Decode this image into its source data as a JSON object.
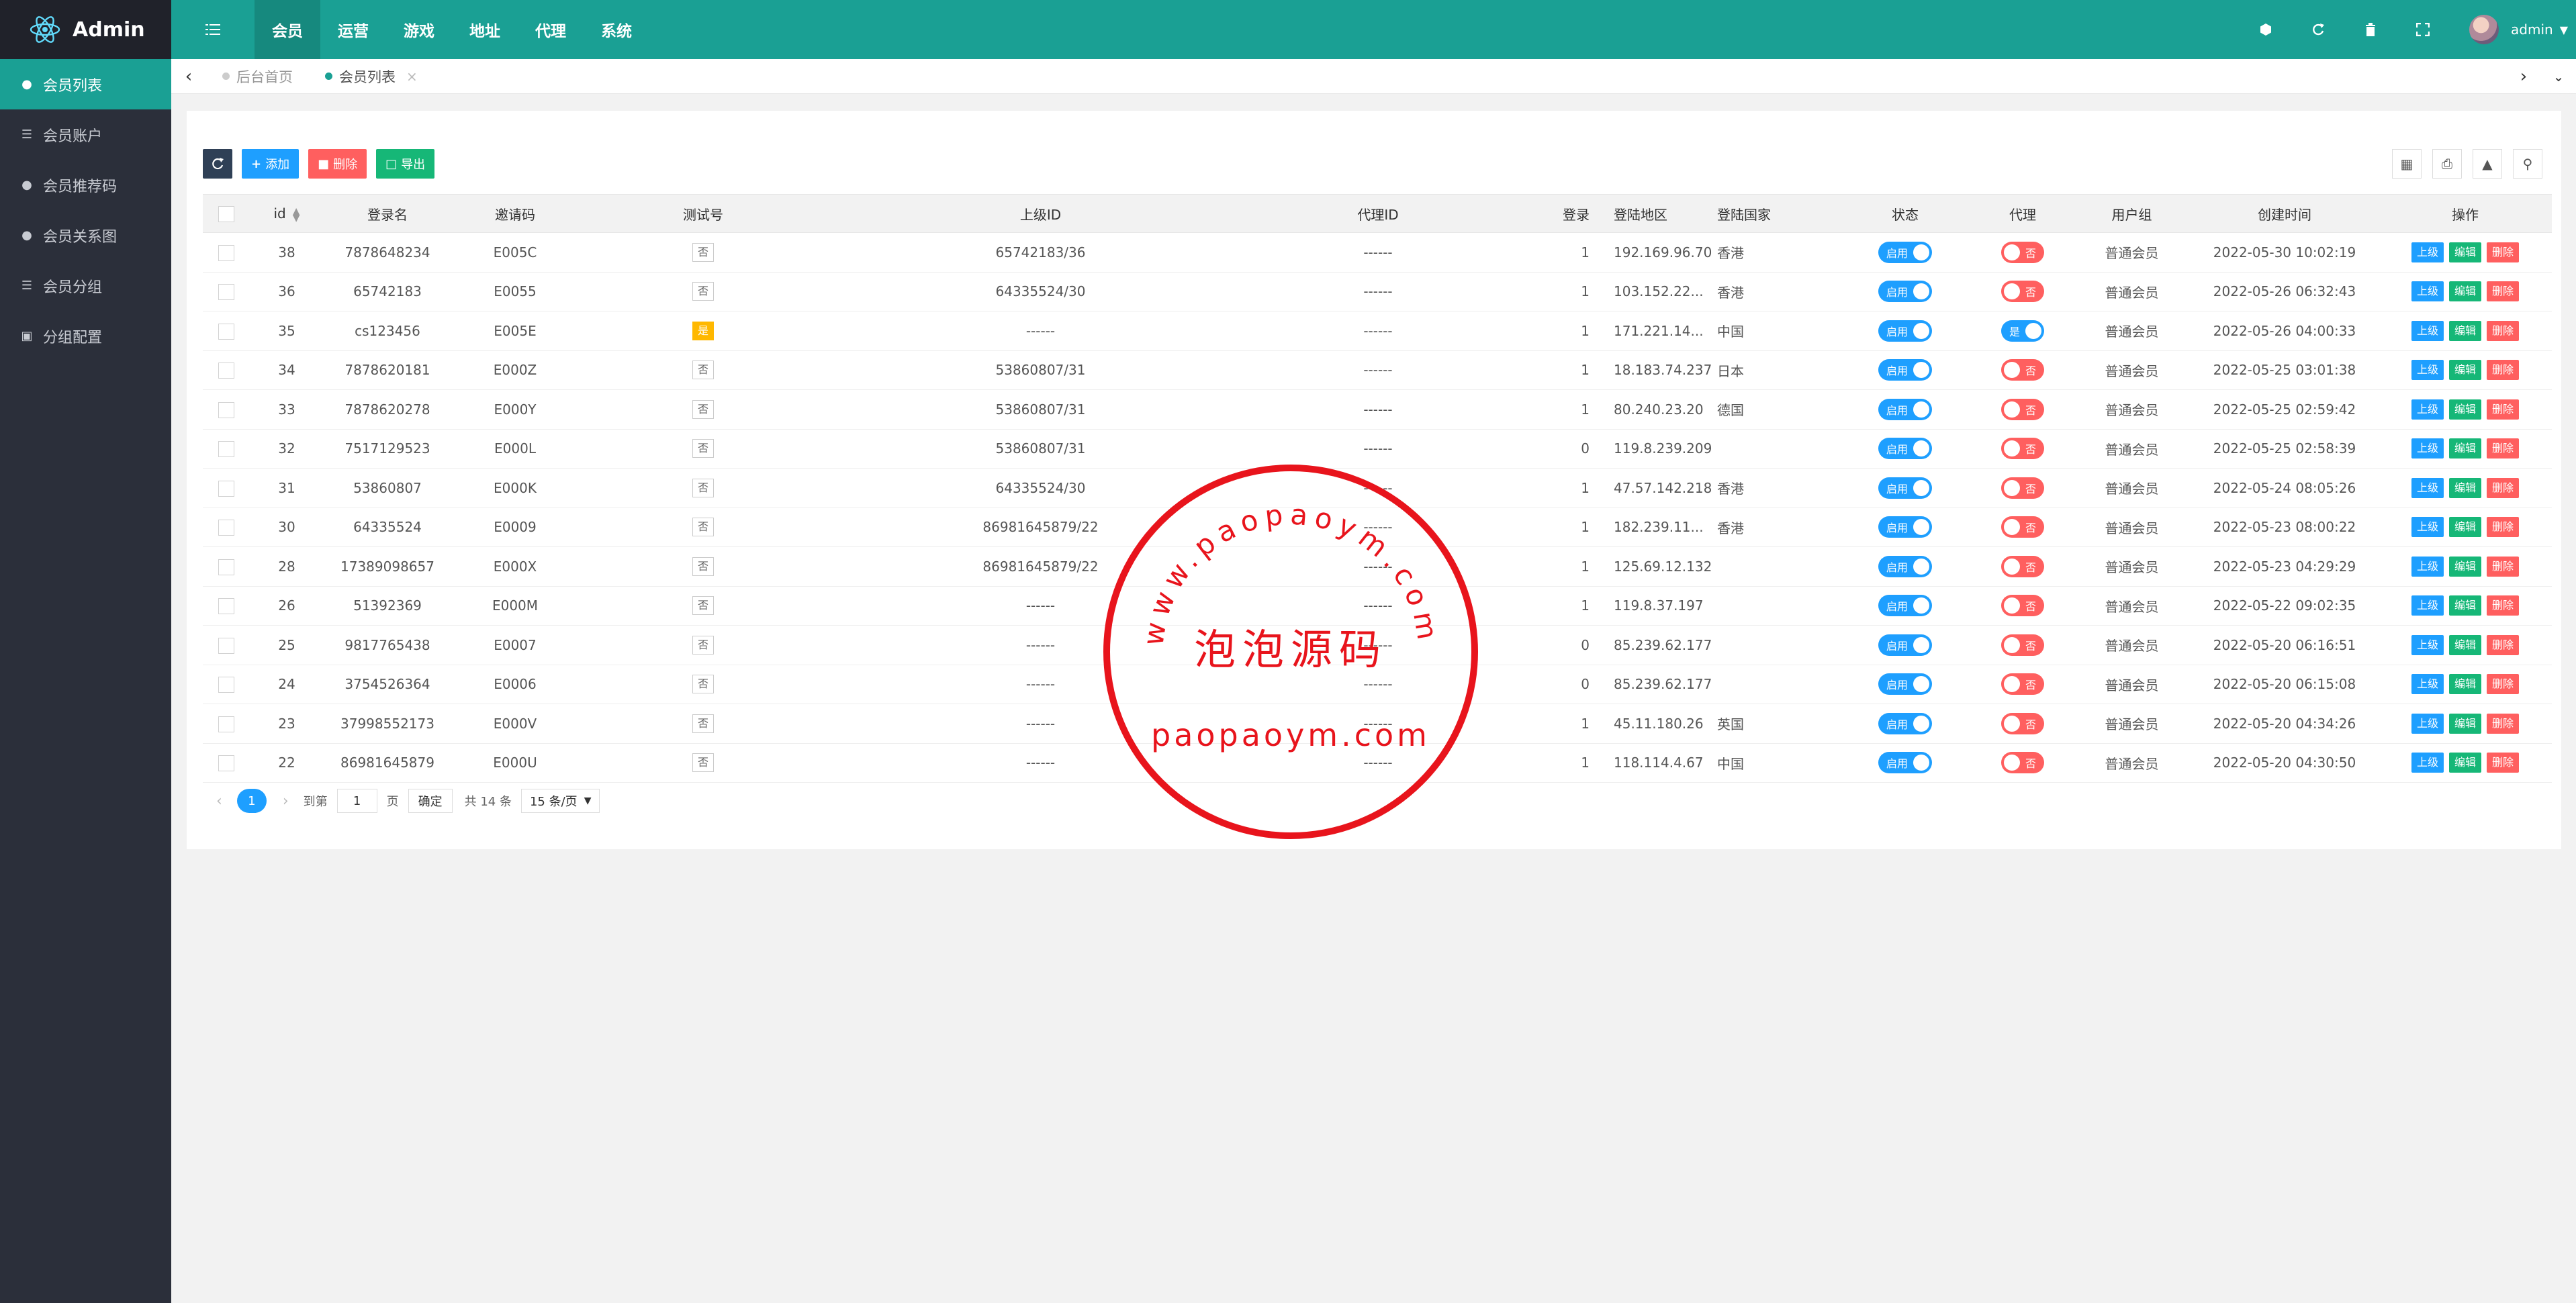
{
  "app": {
    "title": "Admin"
  },
  "header": {
    "nav": [
      "会员",
      "运营",
      "游戏",
      "地址",
      "代理",
      "系统"
    ],
    "username": "admin"
  },
  "sidebar": {
    "items": [
      {
        "label": "会员列表",
        "icon": "user-icon"
      },
      {
        "label": "会员账户",
        "icon": "list-icon"
      },
      {
        "label": "会员推荐码",
        "icon": "user-plus-icon"
      },
      {
        "label": "会员关系图",
        "icon": "users-icon"
      },
      {
        "label": "会员分组",
        "icon": "list-icon"
      },
      {
        "label": "分组配置",
        "icon": "file-icon"
      }
    ]
  },
  "tabs": [
    {
      "label": "后台首页"
    },
    {
      "label": "会员列表"
    }
  ],
  "toolbar": {
    "add": "添加",
    "delete": "删除",
    "export": "导出"
  },
  "table": {
    "columns": [
      "id",
      "登录名",
      "邀请码",
      "测试号",
      "上级ID",
      "代理ID",
      "登录",
      "登陆地区",
      "登陆国家",
      "状态",
      "代理",
      "用户组",
      "创建时间",
      "操作"
    ],
    "labels": {
      "on": "启用",
      "yes": "是",
      "no": "否",
      "up": "上级",
      "edit": "编辑",
      "del": "删除"
    },
    "rows": [
      {
        "id": "38",
        "login": "7878648234",
        "code": "E005C",
        "test": "否",
        "parent": "65742183/36",
        "agent": "------",
        "logins": "1",
        "ip": "192.169.96.70",
        "country": "香港",
        "status": "启用",
        "isagent": "否",
        "group": "普通会员",
        "created": "2022-05-30 10:02:19"
      },
      {
        "id": "36",
        "login": "65742183",
        "code": "E0055",
        "test": "否",
        "parent": "64335524/30",
        "agent": "------",
        "logins": "1",
        "ip": "103.152.22...",
        "country": "香港",
        "status": "启用",
        "isagent": "否",
        "group": "普通会员",
        "created": "2022-05-26 06:32:43"
      },
      {
        "id": "35",
        "login": "cs123456",
        "code": "E005E",
        "test": "是",
        "parent": "------",
        "agent": "------",
        "logins": "1",
        "ip": "171.221.14...",
        "country": "中国",
        "status": "启用",
        "isagent": "是",
        "group": "普通会员",
        "created": "2022-05-26 04:00:33"
      },
      {
        "id": "34",
        "login": "7878620181",
        "code": "E000Z",
        "test": "否",
        "parent": "53860807/31",
        "agent": "------",
        "logins": "1",
        "ip": "18.183.74.237",
        "country": "日本",
        "status": "启用",
        "isagent": "否",
        "group": "普通会员",
        "created": "2022-05-25 03:01:38"
      },
      {
        "id": "33",
        "login": "7878620278",
        "code": "E000Y",
        "test": "否",
        "parent": "53860807/31",
        "agent": "------",
        "logins": "1",
        "ip": "80.240.23.20",
        "country": "德国",
        "status": "启用",
        "isagent": "否",
        "group": "普通会员",
        "created": "2022-05-25 02:59:42"
      },
      {
        "id": "32",
        "login": "7517129523",
        "code": "E000L",
        "test": "否",
        "parent": "53860807/31",
        "agent": "------",
        "logins": "0",
        "ip": "119.8.239.209",
        "country": "",
        "status": "启用",
        "isagent": "否",
        "group": "普通会员",
        "created": "2022-05-25 02:58:39"
      },
      {
        "id": "31",
        "login": "53860807",
        "code": "E000K",
        "test": "否",
        "parent": "64335524/30",
        "agent": "------",
        "logins": "1",
        "ip": "47.57.142.218",
        "country": "香港",
        "status": "启用",
        "isagent": "否",
        "group": "普通会员",
        "created": "2022-05-24 08:05:26"
      },
      {
        "id": "30",
        "login": "64335524",
        "code": "E0009",
        "test": "否",
        "parent": "86981645879/22",
        "agent": "------",
        "logins": "1",
        "ip": "182.239.11...",
        "country": "香港",
        "status": "启用",
        "isagent": "否",
        "group": "普通会员",
        "created": "2022-05-23 08:00:22"
      },
      {
        "id": "28",
        "login": "17389098657",
        "code": "E000X",
        "test": "否",
        "parent": "86981645879/22",
        "agent": "------",
        "logins": "1",
        "ip": "125.69.12.132",
        "country": "",
        "status": "启用",
        "isagent": "否",
        "group": "普通会员",
        "created": "2022-05-23 04:29:29"
      },
      {
        "id": "26",
        "login": "51392369",
        "code": "E000M",
        "test": "否",
        "parent": "------",
        "agent": "------",
        "logins": "1",
        "ip": "119.8.37.197",
        "country": "",
        "status": "启用",
        "isagent": "否",
        "group": "普通会员",
        "created": "2022-05-22 09:02:35"
      },
      {
        "id": "25",
        "login": "9817765438",
        "code": "E0007",
        "test": "否",
        "parent": "------",
        "agent": "------",
        "logins": "0",
        "ip": "85.239.62.177",
        "country": "",
        "status": "启用",
        "isagent": "否",
        "group": "普通会员",
        "created": "2022-05-20 06:16:51"
      },
      {
        "id": "24",
        "login": "3754526364",
        "code": "E0006",
        "test": "否",
        "parent": "------",
        "agent": "------",
        "logins": "0",
        "ip": "85.239.62.177",
        "country": "",
        "status": "启用",
        "isagent": "否",
        "group": "普通会员",
        "created": "2022-05-20 06:15:08"
      },
      {
        "id": "23",
        "login": "37998552173",
        "code": "E000V",
        "test": "否",
        "parent": "------",
        "agent": "------",
        "logins": "1",
        "ip": "45.11.180.26",
        "country": "英国",
        "status": "启用",
        "isagent": "否",
        "group": "普通会员",
        "created": "2022-05-20 04:34:26"
      },
      {
        "id": "22",
        "login": "86981645879",
        "code": "E000U",
        "test": "否",
        "parent": "------",
        "agent": "------",
        "logins": "1",
        "ip": "118.114.4.67",
        "country": "中国",
        "status": "启用",
        "isagent": "否",
        "group": "普通会员",
        "created": "2022-05-20 04:30:50"
      }
    ]
  },
  "pager": {
    "current": "1",
    "goto_label": "到第",
    "goto_value": "1",
    "page_unit": "页",
    "confirm": "确定",
    "total": "共 14 条",
    "page_size": "15 条/页"
  },
  "watermark": {
    "url_text": "www.paopaoym.com",
    "title": "泡泡源码",
    "domain": "paopaoym.com",
    "color": "#e8141c"
  }
}
